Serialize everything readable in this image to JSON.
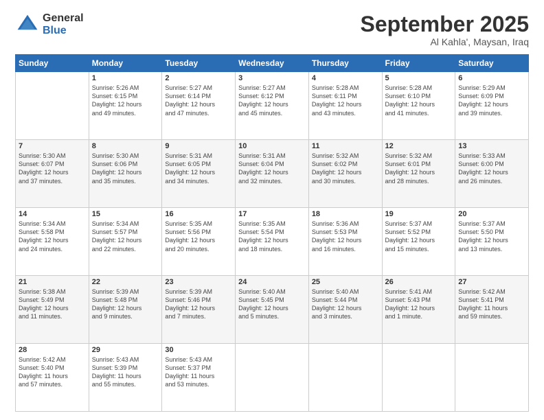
{
  "logo": {
    "general": "General",
    "blue": "Blue"
  },
  "header": {
    "month": "September 2025",
    "location": "Al Kahla', Maysan, Iraq"
  },
  "days_of_week": [
    "Sunday",
    "Monday",
    "Tuesday",
    "Wednesday",
    "Thursday",
    "Friday",
    "Saturday"
  ],
  "weeks": [
    [
      {
        "day": "",
        "info": ""
      },
      {
        "day": "1",
        "info": "Sunrise: 5:26 AM\nSunset: 6:15 PM\nDaylight: 12 hours\nand 49 minutes."
      },
      {
        "day": "2",
        "info": "Sunrise: 5:27 AM\nSunset: 6:14 PM\nDaylight: 12 hours\nand 47 minutes."
      },
      {
        "day": "3",
        "info": "Sunrise: 5:27 AM\nSunset: 6:12 PM\nDaylight: 12 hours\nand 45 minutes."
      },
      {
        "day": "4",
        "info": "Sunrise: 5:28 AM\nSunset: 6:11 PM\nDaylight: 12 hours\nand 43 minutes."
      },
      {
        "day": "5",
        "info": "Sunrise: 5:28 AM\nSunset: 6:10 PM\nDaylight: 12 hours\nand 41 minutes."
      },
      {
        "day": "6",
        "info": "Sunrise: 5:29 AM\nSunset: 6:09 PM\nDaylight: 12 hours\nand 39 minutes."
      }
    ],
    [
      {
        "day": "7",
        "info": "Sunrise: 5:30 AM\nSunset: 6:07 PM\nDaylight: 12 hours\nand 37 minutes."
      },
      {
        "day": "8",
        "info": "Sunrise: 5:30 AM\nSunset: 6:06 PM\nDaylight: 12 hours\nand 35 minutes."
      },
      {
        "day": "9",
        "info": "Sunrise: 5:31 AM\nSunset: 6:05 PM\nDaylight: 12 hours\nand 34 minutes."
      },
      {
        "day": "10",
        "info": "Sunrise: 5:31 AM\nSunset: 6:04 PM\nDaylight: 12 hours\nand 32 minutes."
      },
      {
        "day": "11",
        "info": "Sunrise: 5:32 AM\nSunset: 6:02 PM\nDaylight: 12 hours\nand 30 minutes."
      },
      {
        "day": "12",
        "info": "Sunrise: 5:32 AM\nSunset: 6:01 PM\nDaylight: 12 hours\nand 28 minutes."
      },
      {
        "day": "13",
        "info": "Sunrise: 5:33 AM\nSunset: 6:00 PM\nDaylight: 12 hours\nand 26 minutes."
      }
    ],
    [
      {
        "day": "14",
        "info": "Sunrise: 5:34 AM\nSunset: 5:58 PM\nDaylight: 12 hours\nand 24 minutes."
      },
      {
        "day": "15",
        "info": "Sunrise: 5:34 AM\nSunset: 5:57 PM\nDaylight: 12 hours\nand 22 minutes."
      },
      {
        "day": "16",
        "info": "Sunrise: 5:35 AM\nSunset: 5:56 PM\nDaylight: 12 hours\nand 20 minutes."
      },
      {
        "day": "17",
        "info": "Sunrise: 5:35 AM\nSunset: 5:54 PM\nDaylight: 12 hours\nand 18 minutes."
      },
      {
        "day": "18",
        "info": "Sunrise: 5:36 AM\nSunset: 5:53 PM\nDaylight: 12 hours\nand 16 minutes."
      },
      {
        "day": "19",
        "info": "Sunrise: 5:37 AM\nSunset: 5:52 PM\nDaylight: 12 hours\nand 15 minutes."
      },
      {
        "day": "20",
        "info": "Sunrise: 5:37 AM\nSunset: 5:50 PM\nDaylight: 12 hours\nand 13 minutes."
      }
    ],
    [
      {
        "day": "21",
        "info": "Sunrise: 5:38 AM\nSunset: 5:49 PM\nDaylight: 12 hours\nand 11 minutes."
      },
      {
        "day": "22",
        "info": "Sunrise: 5:39 AM\nSunset: 5:48 PM\nDaylight: 12 hours\nand 9 minutes."
      },
      {
        "day": "23",
        "info": "Sunrise: 5:39 AM\nSunset: 5:46 PM\nDaylight: 12 hours\nand 7 minutes."
      },
      {
        "day": "24",
        "info": "Sunrise: 5:40 AM\nSunset: 5:45 PM\nDaylight: 12 hours\nand 5 minutes."
      },
      {
        "day": "25",
        "info": "Sunrise: 5:40 AM\nSunset: 5:44 PM\nDaylight: 12 hours\nand 3 minutes."
      },
      {
        "day": "26",
        "info": "Sunrise: 5:41 AM\nSunset: 5:43 PM\nDaylight: 12 hours\nand 1 minute."
      },
      {
        "day": "27",
        "info": "Sunrise: 5:42 AM\nSunset: 5:41 PM\nDaylight: 11 hours\nand 59 minutes."
      }
    ],
    [
      {
        "day": "28",
        "info": "Sunrise: 5:42 AM\nSunset: 5:40 PM\nDaylight: 11 hours\nand 57 minutes."
      },
      {
        "day": "29",
        "info": "Sunrise: 5:43 AM\nSunset: 5:39 PM\nDaylight: 11 hours\nand 55 minutes."
      },
      {
        "day": "30",
        "info": "Sunrise: 5:43 AM\nSunset: 5:37 PM\nDaylight: 11 hours\nand 53 minutes."
      },
      {
        "day": "",
        "info": ""
      },
      {
        "day": "",
        "info": ""
      },
      {
        "day": "",
        "info": ""
      },
      {
        "day": "",
        "info": ""
      }
    ]
  ]
}
